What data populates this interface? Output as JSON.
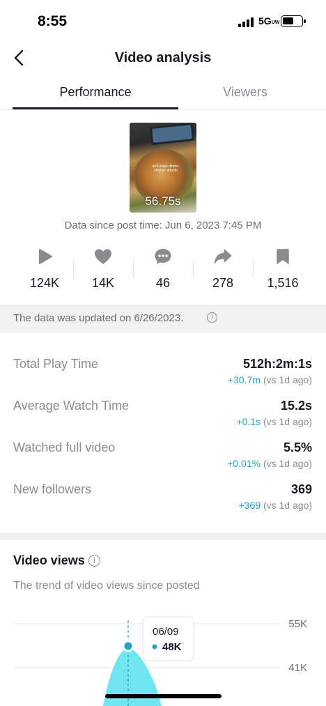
{
  "status_bar": {
    "time": "8:55",
    "network": "5G",
    "network_suffix": "UW"
  },
  "header": {
    "title": "Video analysis",
    "back_icon": "chevron-left-icon"
  },
  "tabs": [
    {
      "label": "Performance",
      "active": true
    },
    {
      "label": "Viewers",
      "active": false
    }
  ],
  "video": {
    "duration": "56.75s",
    "caption": "let's make dinner: chicken alfredo",
    "data_since": "Data since post time: Jun 6, 2023 7:45 PM"
  },
  "engagement": [
    {
      "icon": "play-icon",
      "value": "124K"
    },
    {
      "icon": "heart-icon",
      "value": "14K"
    },
    {
      "icon": "comment-icon",
      "value": "46"
    },
    {
      "icon": "share-icon",
      "value": "278"
    },
    {
      "icon": "bookmark-icon",
      "value": "1,516"
    }
  ],
  "update_notice": "The data was updated on 6/26/2023.",
  "metrics": [
    {
      "label": "Total Play Time",
      "value": "512h:2m:1s",
      "delta": "+30.7m",
      "compare": "(vs 1d ago)"
    },
    {
      "label": "Average Watch Time",
      "value": "15.2s",
      "delta": "+0.1s",
      "compare": "(vs 1d ago)"
    },
    {
      "label": "Watched full video",
      "value": "5.5%",
      "delta": "+0.01%",
      "compare": "(vs 1d ago)"
    },
    {
      "label": "New followers",
      "value": "369",
      "delta": "+369",
      "compare": "(vs 1d ago)"
    }
  ],
  "video_views": {
    "title": "Video views",
    "subtitle": "The trend of video views since posted"
  },
  "colors": {
    "accent": "#20a6bd",
    "area_fill": "#5fe3ee",
    "text": "#161823",
    "muted": "#8a8b91"
  },
  "chart_data": {
    "type": "area",
    "y_ticks": [
      "55K",
      "41K"
    ],
    "tooltip": {
      "date": "06/09",
      "value": "48K"
    },
    "highlight": {
      "x": "06/09",
      "y": 48000
    },
    "grid": true
  }
}
